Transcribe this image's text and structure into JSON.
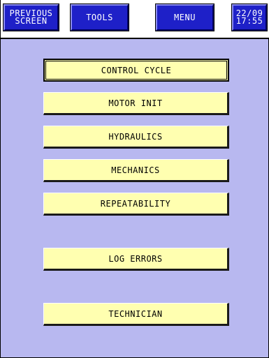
{
  "topbar": {
    "previous_line1": "PREVIOUS",
    "previous_line2": "SCREEN",
    "tools_label": "TOOLS",
    "menu_label": "MENU",
    "date": "22/09",
    "time": "17:55"
  },
  "menu": {
    "control_cycle": "CONTROL CYCLE",
    "motor_init": "MOTOR INIT",
    "hydraulics": "HYDRAULICS",
    "mechanics": "MECHANICS",
    "repeatability": "REPEATABILITY",
    "log_errors": "LOG ERRORS",
    "technician": "TECHNICIAN"
  },
  "colors": {
    "background": "#b8b8f0",
    "topbar_button": "#1e20c8",
    "menu_button": "#ffffb0"
  }
}
